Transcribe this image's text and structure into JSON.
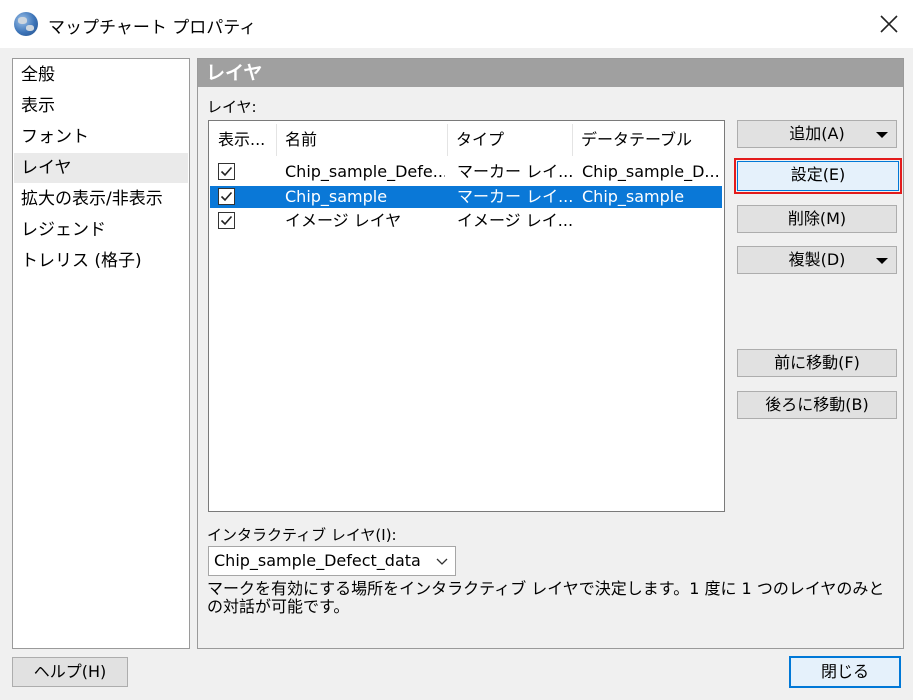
{
  "window": {
    "title": "マップチャート プロパティ",
    "icon": "globe-icon",
    "close_icon": "close-icon"
  },
  "nav": {
    "items": [
      "全般",
      "表示",
      "フォント",
      "レイヤ",
      "拡大の表示/非表示",
      "レジェンド",
      "トレリス (格子)"
    ],
    "selected": "レイヤ"
  },
  "section_title": "レイヤ",
  "layers": {
    "label": "レイヤ:",
    "columns": [
      "表示...",
      "名前",
      "タイプ",
      "データテーブル"
    ],
    "rows": [
      {
        "visible": true,
        "name": "Chip_sample_Defe...",
        "type": "マーカー レイ...",
        "table": "Chip_sample_D...",
        "selected": false
      },
      {
        "visible": true,
        "name": "Chip_sample",
        "type": "マーカー レイ...",
        "table": "Chip_sample",
        "selected": true
      },
      {
        "visible": true,
        "name": "イメージ レイヤ",
        "type": "イメージ レイ...",
        "table": "",
        "selected": false
      }
    ]
  },
  "buttons": {
    "add": "追加(A)",
    "settings": "設定(E)",
    "delete": "削除(M)",
    "duplicate": "複製(D)",
    "move_up": "前に移動(F)",
    "move_down": "後ろに移動(B)",
    "help": "ヘルプ(H)",
    "close": "閉じる"
  },
  "interactive_layer": {
    "label": "インタラクティブ レイヤ(I):",
    "value": "Chip_sample_Defect_data",
    "help": "マークを有効にする場所をインタラクティブ レイヤで決定します。1 度に 1 つのレイヤのみとの対話が可能です。"
  },
  "colors": {
    "selection": "#0a78d7",
    "header": "#a0a0a0",
    "highlight": "#e31b1b"
  }
}
